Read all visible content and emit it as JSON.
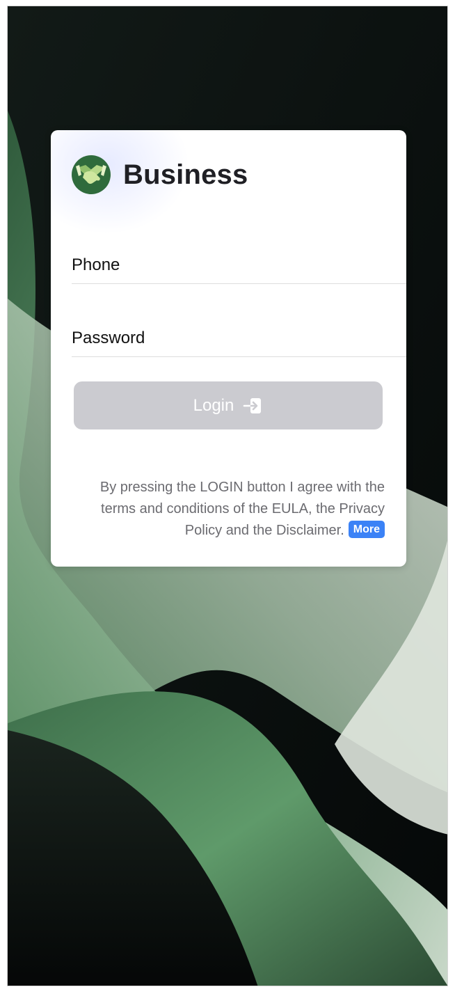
{
  "app": {
    "title": "Business",
    "logo_icon": "handshake-icon"
  },
  "form": {
    "phone_placeholder": "Phone",
    "phone_value": "",
    "password_placeholder": "Password",
    "password_value": ""
  },
  "login_button": {
    "label": "Login",
    "icon": "sign-in-icon",
    "state": "disabled"
  },
  "terms": {
    "text": "By pressing the LOGIN button I agree with the terms and conditions of the EULA, the Privacy Policy and the Disclaimer.",
    "more_label": "More"
  },
  "colors": {
    "accent": "#3b82f6",
    "button_disabled": "#cbcbd0",
    "title_text": "#1f1f24",
    "wallpaper_green": "#4f8a5e"
  }
}
